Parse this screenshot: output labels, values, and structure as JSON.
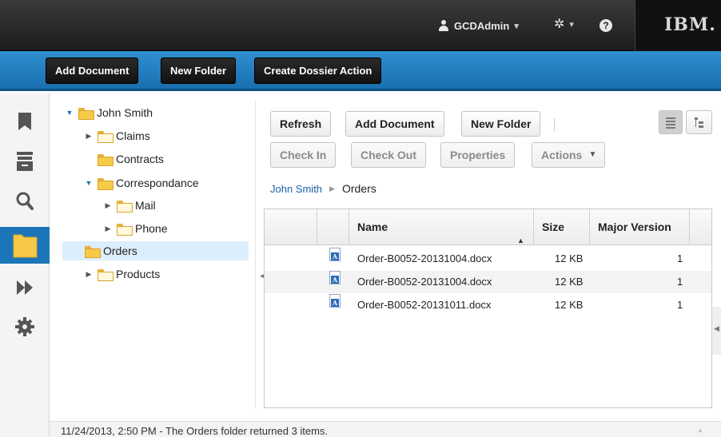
{
  "header": {
    "username": "GCDAdmin",
    "brand": "IBM.",
    "user_caret": "▾",
    "settings_caret": "▾",
    "help_glyph": "?"
  },
  "action_bar": {
    "buttons": [
      "Add Document",
      "New Folder",
      "Create Dossier Action"
    ]
  },
  "sidebar": {
    "icons": [
      "bookmark-icon",
      "archive-box-icon",
      "search-icon",
      "folder-icon",
      "fast-forward-icon",
      "gear-icon"
    ],
    "selected": "folder-icon"
  },
  "tree": {
    "nodes": [
      {
        "label": "John Smith",
        "expanded": true
      },
      {
        "label": "Claims",
        "expanded": false
      },
      {
        "label": "Contracts"
      },
      {
        "label": "Correspondance",
        "expanded": true
      },
      {
        "label": "Mail",
        "expanded": false
      },
      {
        "label": "Phone",
        "expanded": false
      },
      {
        "label": "Orders",
        "selected": true
      },
      {
        "label": "Products",
        "expanded": false
      }
    ]
  },
  "toolbar": {
    "refresh": "Refresh",
    "add_document": "Add Document",
    "new_folder": "New Folder",
    "check_in": "Check In",
    "check_out": "Check Out",
    "properties": "Properties",
    "actions": "Actions"
  },
  "breadcrumb": {
    "root": "John Smith",
    "current": "Orders"
  },
  "grid": {
    "columns": [
      "Name",
      "Size",
      "Major Version"
    ],
    "rows": [
      {
        "name": "Order-B0052-20131004.docx",
        "size": "12 KB",
        "version": "1"
      },
      {
        "name": "Order-B0052-20131004.docx",
        "size": "12 KB",
        "version": "1"
      },
      {
        "name": "Order-B0052-20131011.docx",
        "size": "12 KB",
        "version": "1"
      }
    ]
  },
  "status": {
    "message": "11/24/2013, 2:50 PM - The Orders folder returned 3 items."
  },
  "colors": {
    "action_bar_blue": "#1a76b8",
    "selection_bg": "#dceefb",
    "link": "#1a64a8"
  }
}
